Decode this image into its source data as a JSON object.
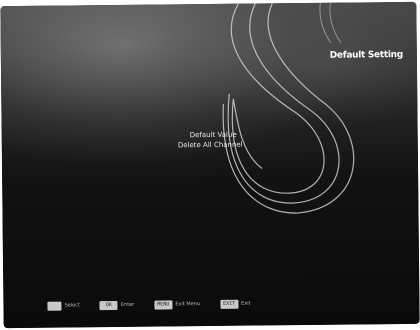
{
  "screen": {
    "title": "Default Setting",
    "menu": {
      "items": [
        {
          "label": "Default Value"
        },
        {
          "label": "Delete All Channel"
        }
      ]
    },
    "help_bar": [
      {
        "key": "",
        "label": "Select"
      },
      {
        "key": "OK",
        "label": "Enter"
      },
      {
        "key": "MENU",
        "label": "Exit Menu"
      },
      {
        "key": "EXIT",
        "label": "Exit"
      }
    ]
  }
}
